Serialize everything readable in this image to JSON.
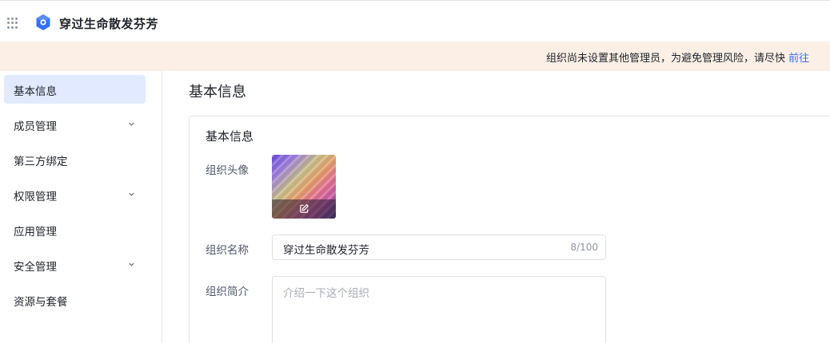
{
  "header": {
    "app_title": "穿过生命散发芬芳"
  },
  "banner": {
    "text": "组织尚未设置其他管理员，为避免管理风险，请尽快 ",
    "link_label": "前往"
  },
  "sidebar": {
    "items": [
      {
        "label": "基本信息",
        "active": true,
        "expandable": false
      },
      {
        "label": "成员管理",
        "active": false,
        "expandable": true
      },
      {
        "label": "第三方绑定",
        "active": false,
        "expandable": false
      },
      {
        "label": "权限管理",
        "active": false,
        "expandable": true
      },
      {
        "label": "应用管理",
        "active": false,
        "expandable": false
      },
      {
        "label": "安全管理",
        "active": false,
        "expandable": true
      },
      {
        "label": "资源与套餐",
        "active": false,
        "expandable": false
      }
    ]
  },
  "main": {
    "page_title": "基本信息",
    "card": {
      "title": "基本信息",
      "avatar_label": "组织头像",
      "name_label": "组织名称",
      "name_value": "穿过生命散发芬芳",
      "name_count": "8/100",
      "intro_label": "组织简介",
      "intro_placeholder": "介绍一下这个组织"
    }
  },
  "icons": {
    "app_grid": "app-grid-icon",
    "logo": "logo-icon",
    "chevron": "chevron-down-icon",
    "edit": "edit-icon"
  },
  "colors": {
    "accent": "#3370ff",
    "active_nav_bg": "#e1eaff",
    "banner_bg": "#fcefe6",
    "logo_blue": "#3370ff"
  }
}
